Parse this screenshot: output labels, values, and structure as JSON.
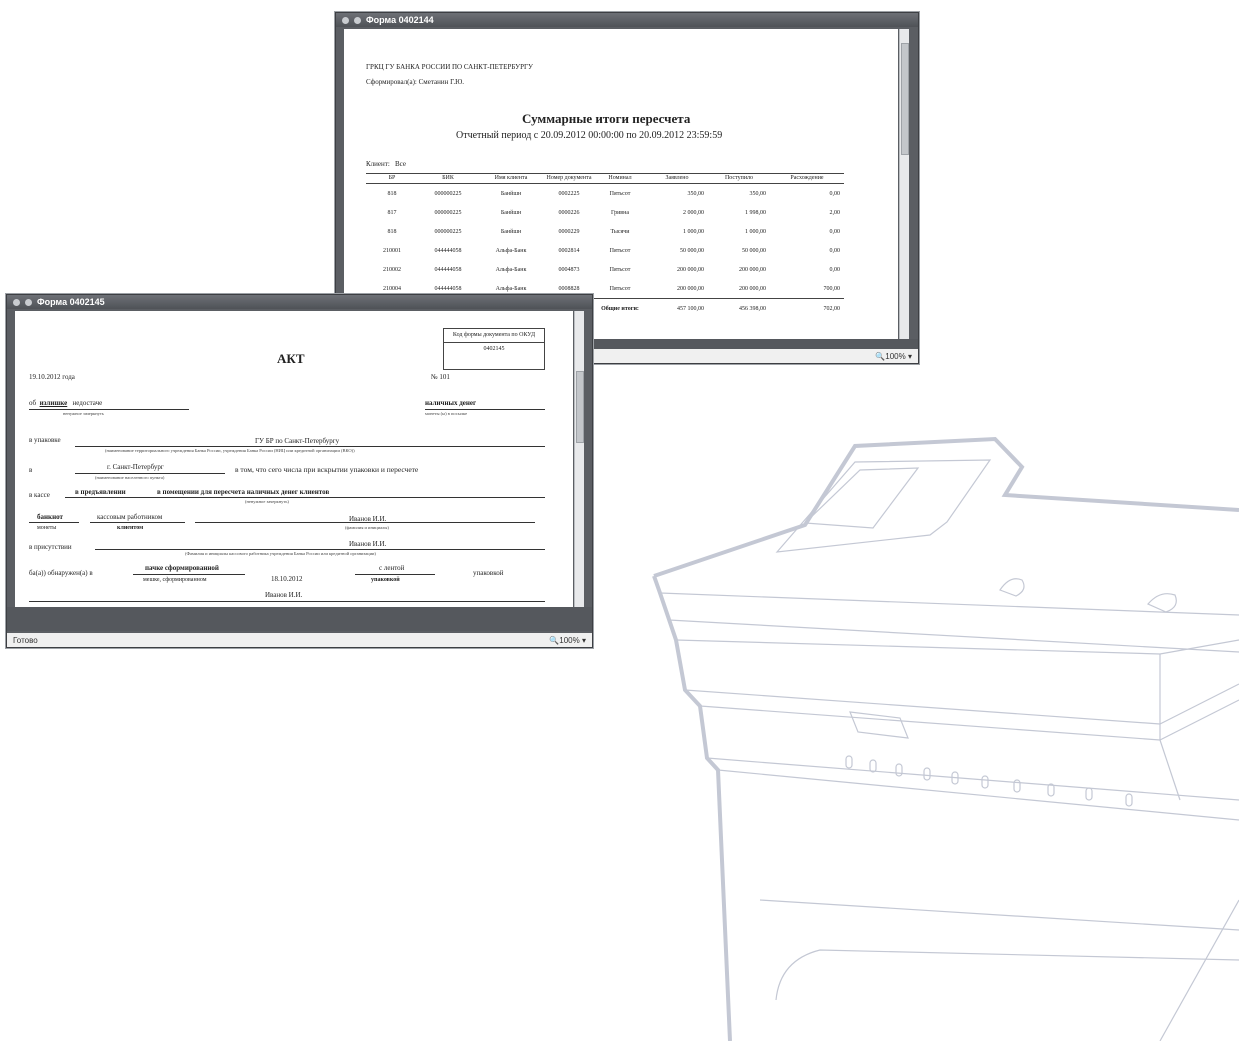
{
  "window_summary": {
    "title": "Форма 0402144",
    "header_line1": "ГРКЦ ГУ БАНКА РОССИИ ПО САНКТ-ПЕТЕРБУРГУ",
    "header_line2_label": "Сформировал(а):",
    "header_line2_value": "Сметанин Г.Ю.",
    "report_title": "Суммарные итоги пересчета",
    "period_label": "Отчетный период с",
    "period_from": "20.09.2012 00:00:00",
    "period_sep": "по",
    "period_to": "20.09.2012 23:59:59",
    "client_label": "Клиент:",
    "client_value": "Все",
    "columns": [
      "БР",
      "БИК",
      "Имя клиента",
      "Номер документа",
      "Номинал",
      "Заявлено",
      "Поступило",
      "Расхождение"
    ],
    "rows": [
      [
        "818",
        "000000225",
        "Банйшн",
        "0002225",
        "Пятьсот",
        "350,00",
        "350,00",
        "0,00"
      ],
      [
        "817",
        "000000225",
        "Банйшн",
        "0000226",
        "Гривна",
        "2 000,00",
        "1 998,00",
        "2,00"
      ],
      [
        "818",
        "000000225",
        "Банйшн",
        "0000229",
        "Тысячи",
        "1 000,00",
        "1 000,00",
        "0,00"
      ],
      [
        "210001",
        "044444058",
        "Альфа-Банк",
        "0002814",
        "Пятьсот",
        "50 000,00",
        "50 000,00",
        "0,00"
      ],
      [
        "210002",
        "044444058",
        "Альфа-Банк",
        "0004873",
        "Пятьсот",
        "200 000,00",
        "200 000,00",
        "0,00"
      ],
      [
        "210004",
        "044444058",
        "Альфа-Банк",
        "0008828",
        "Пятьсот",
        "200 000,00",
        "200 000,00",
        "700,00"
      ]
    ],
    "totals_label": "Общие итоги:",
    "totals": [
      "457 100,00",
      "456 398,00",
      "702,00"
    ],
    "zoom": "100%"
  },
  "window_act": {
    "title": "Форма 0402145",
    "form_code_label": "Код формы документа по ОКУД",
    "form_code_value": "0402145",
    "heading": "АКТ",
    "date": "19.10.2012 года",
    "number": "№ 101",
    "line1_prefix": "об",
    "line1_a": "излишке",
    "line1_b": "недостаче",
    "line1_c": "наличных денег",
    "line1_caption": "ненужное зачеркнуть",
    "line1_caption_right": "монеты (ы) в посылке",
    "line2_label": "в упаковке",
    "line2_value": "ГУ БР по Санкт-Петербургу",
    "line2_caption": "(наименование территориального учреждения Банка России, учреждения Банка России (НИЦ или кредитной организации (ВКО))",
    "line3_label": "в",
    "line3_value": "г. Санкт-Петербург",
    "line3_rest": "в том, что сего числа при вскрытии упаковки и пересчете",
    "line3_caption": "(наименование населенного пункта)",
    "line4_label": "в кассе",
    "line4_a": "в предъявлении",
    "line4_b": "в помещении для пересчета наличных денег клиентов",
    "line4_caption": "(ненужное зачеркнуть)",
    "line5_a": "банкнот",
    "line5_b": "кассовым работником",
    "line5_value": "Иванов И.И.",
    "line5_caption_a": "монеты",
    "line5_caption_b": "клиентом",
    "line5_caption_c": "(фамилия и инициалы)",
    "line6_label": "в присутствии",
    "line6_value": "Иванов И.И.",
    "line6_caption": "(Фамилия и инициалы кассового работника учреждения Банка России или кредитной организации)",
    "line7_label": "ба(а)) обнаружен(а) в",
    "line7_a": "пачке сформированной",
    "line7_caption_a": "мешке, сформированном",
    "line7_date": "18.10.2012",
    "line7_b": "с лентой",
    "line7_caption_b": "упаковкой",
    "line7_c": "упаковкой",
    "line8_value": "Иванов И.И.",
    "status_left": "Готово",
    "zoom": "100%"
  }
}
